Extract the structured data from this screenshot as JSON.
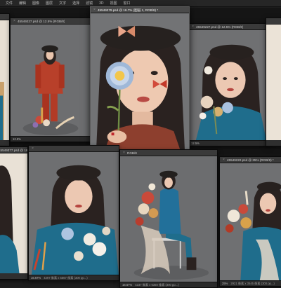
{
  "menubar": {
    "items": [
      "文件",
      "编辑",
      "图像",
      "图层",
      "文字",
      "选择",
      "滤镜",
      "3D",
      "视图",
      "窗口"
    ]
  },
  "windows": {
    "w1": {
      "title": "",
      "zoom": "",
      "info": ""
    },
    "w2": {
      "title": "45549227.psd @ 12.5% (RGB/8)",
      "zoom": "12.5%",
      "info": ""
    },
    "w3": {
      "title": "45549279.psd @ 16.7% (图层 1, RGB/8) *",
      "zoom": "16.67%",
      "info": "4000 像素 x 6100 像素 (300 pp...)"
    },
    "w4": {
      "title": "45549227.psd @ 12.5% (RGB/8)",
      "zoom": "12.5%",
      "info": ""
    },
    "w5": {
      "title": "",
      "zoom": "",
      "info": ""
    },
    "w6": {
      "title": "45549377.psd @ 16.7% (RGB/8)",
      "zoom": "",
      "info": ""
    },
    "w7": {
      "title": "",
      "zoom": "16.67%",
      "info": "4397 像素 x 5567 像素 (300 pp...)"
    },
    "w8": {
      "title": "RGB/8",
      "zoom": "16.67%",
      "info": "4237 像素 x 6350 像素 (300 pp...)"
    },
    "w9": {
      "title": "45549222.psd @ 25% (RGB/8) *",
      "zoom": "25%",
      "info": "2921 像素 x 3545 像素 (300 pp...)"
    },
    "w10": {
      "title": "",
      "zoom": "",
      "info": ""
    }
  },
  "colors": {
    "workspace": "#151515",
    "backdrop_gray": "#6e6f71",
    "beret": "#2a2522",
    "red_suit": "#b23a26",
    "teal_suit": "#1f6d8c",
    "cream_wall": "#e9e1d6"
  }
}
